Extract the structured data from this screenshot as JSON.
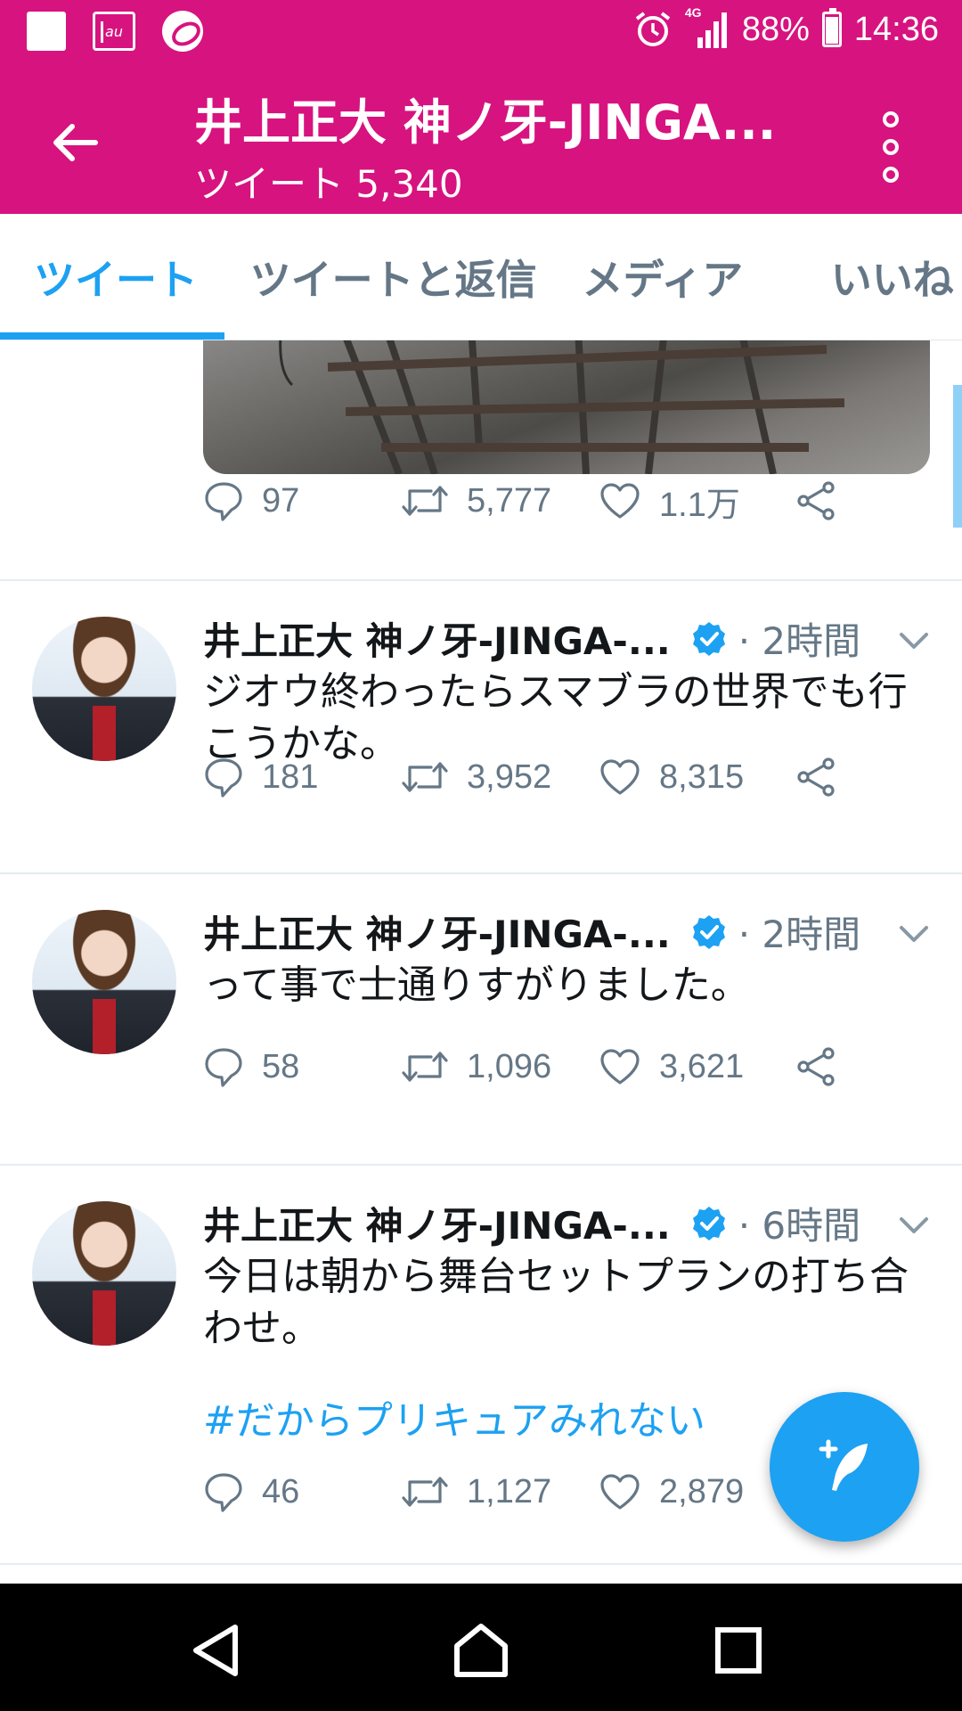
{
  "status_bar": {
    "au_label": "au",
    "network": "4G",
    "battery": "88%",
    "battery_level": 0.88,
    "time": "14:36"
  },
  "app_bar": {
    "title": "井上正大 神ノ牙-JINGA...",
    "subtitle": "ツイート 5,340"
  },
  "tabs": [
    {
      "label": "ツイート",
      "active": true
    },
    {
      "label": "ツイートと返信",
      "active": false
    },
    {
      "label": "メディア",
      "active": false
    },
    {
      "label": "いいね",
      "active": false
    }
  ],
  "media_tweet_actions": {
    "replies": "97",
    "retweets": "5,777",
    "likes": "1.1万"
  },
  "tweets": [
    {
      "name": "井上正大 神ノ牙-JINGA-...",
      "time": "· 2時間",
      "text": "ジオウ終わったらスマブラの世界でも行こうかな。",
      "hashtag": "",
      "replies": "181",
      "retweets": "3,952",
      "likes": "8,315"
    },
    {
      "name": "井上正大 神ノ牙-JINGA-...",
      "time": "· 2時間",
      "text": "って事で士通りすがりました。",
      "hashtag": "",
      "replies": "58",
      "retweets": "1,096",
      "likes": "3,621"
    },
    {
      "name": "井上正大 神ノ牙-JINGA-...",
      "time": "· 6時間",
      "text": "今日は朝から舞台セットプランの打ち合わせ。",
      "hashtag": "#だからプリキュアみれない",
      "replies": "46",
      "retweets": "1,127",
      "likes": "2,879"
    }
  ],
  "colors": {
    "header": "#d7137f",
    "accent": "#1da1f2",
    "muted": "#657786"
  },
  "icons": {
    "back": "arrow-left-icon",
    "more": "more-vertical-icon",
    "reply": "reply-icon",
    "retweet": "retweet-icon",
    "like": "heart-icon",
    "share": "share-icon",
    "verified": "verified-badge-icon",
    "caret": "chevron-down-icon",
    "compose": "compose-tweet-icon"
  }
}
